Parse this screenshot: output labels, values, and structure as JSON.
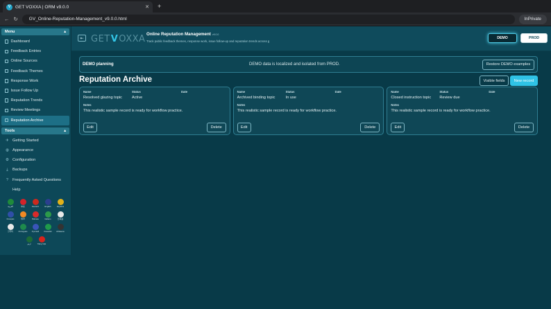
{
  "browser": {
    "tab_title": "GET VOXXA | ORM v9.0.0",
    "tab_favicon": "V",
    "close_glyph": "✕",
    "new_tab_glyph": "+",
    "back_glyph": "←",
    "reload_glyph": "↻",
    "url": "GV_Online-Reputation-Management_v9.0.0.html",
    "inprivate_label": "InPrivate"
  },
  "sidebar": {
    "menu_title": "Menu",
    "menu_collapse_glyph": "▴",
    "menu_items": [
      {
        "label": "Dashboard"
      },
      {
        "label": "Feedback Entries"
      },
      {
        "label": "Online Sources"
      },
      {
        "label": "Feedback Themes"
      },
      {
        "label": "Response Work"
      },
      {
        "label": "Issue Follow Up"
      },
      {
        "label": "Reputation Trends"
      },
      {
        "label": "Review Meetings"
      },
      {
        "label": "Reputation Archive"
      }
    ],
    "tools_title": "Tools",
    "tools_collapse_glyph": "▴",
    "tool_items": [
      {
        "label": "Getting Started",
        "icon": "rocket-icon",
        "glyph": "✈"
      },
      {
        "label": "Appearance",
        "icon": "palette-icon",
        "glyph": "◍"
      },
      {
        "label": "Configuration",
        "icon": "gear-icon",
        "glyph": "⚙"
      },
      {
        "label": "Backups",
        "icon": "download-icon",
        "glyph": "⤓"
      },
      {
        "label": "Frequently Asked Questions",
        "icon": "question-icon",
        "glyph": "?"
      },
      {
        "label": "Help",
        "icon": "help-icon",
        "glyph": ""
      }
    ],
    "languages": [
      {
        "code": "العربية",
        "color": "#1f8a3b"
      },
      {
        "code": "中文",
        "color": "#d2232a"
      },
      {
        "code": "Deutsch",
        "color": "#cc2a1e"
      },
      {
        "code": "English",
        "color": "#2b3f8f"
      },
      {
        "code": "Español",
        "color": "#e2b21a"
      },
      {
        "code": "Français",
        "color": "#2f4fa8"
      },
      {
        "code": "हिन्दी",
        "color": "#f08a24"
      },
      {
        "code": "Bahasa",
        "color": "#d92b2b"
      },
      {
        "code": "Italiano",
        "color": "#2c9a4a"
      },
      {
        "code": "日本語",
        "color": "#e9e9e9"
      },
      {
        "code": "한국어",
        "color": "#e9e9e9"
      },
      {
        "code": "Português",
        "color": "#1e8a4c"
      },
      {
        "code": "Русский",
        "color": "#3a55b8"
      },
      {
        "code": "Kiswahili",
        "color": "#1f9a4a"
      },
      {
        "code": "Afrikaans",
        "color": "#333333"
      },
      {
        "code": "اردو",
        "color": "#1d6b37"
      },
      {
        "code": "Tiếng Việt",
        "color": "#d8231c"
      }
    ]
  },
  "header": {
    "logo_get": "GET",
    "logo_v": "V",
    "logo_oxxa": "OXXA",
    "title": "Online Reputation Management",
    "version": "v9.0.0",
    "subtitle": "Track public feedback themes, response work, issue follow-up and reputation trends across g",
    "demo_label": "DEMO",
    "prod_label": "PROD",
    "toggle_glyph": "⇤"
  },
  "banner": {
    "title": "DEMO planning",
    "message": "DEMO data is localized and isolated from PROD.",
    "restore_label": "Restore DEMO examples"
  },
  "archive": {
    "title": "Reputation Archive",
    "visible_fields_label": "Visible fields",
    "new_record_label": "New record",
    "labels": {
      "name": "Name",
      "status": "Status",
      "date": "Date",
      "notes": "Notes"
    },
    "edit_label": "Edit",
    "delete_label": "Delete",
    "records": [
      {
        "name": "Resolved glazing topic",
        "status": "Active",
        "date": "",
        "notes": "This realistic sample record is ready for workflow practice."
      },
      {
        "name": "Archived binding topic",
        "status": "In use",
        "date": "",
        "notes": "This realistic sample record is ready for workflow practice."
      },
      {
        "name": "Closed instruction topic",
        "status": "Review due",
        "date": "",
        "notes": "This realistic sample record is ready for workflow practice."
      }
    ]
  },
  "colors": {
    "accent": "#2fc3e6",
    "background": "#083a48",
    "sidebar": "#0d4858"
  }
}
